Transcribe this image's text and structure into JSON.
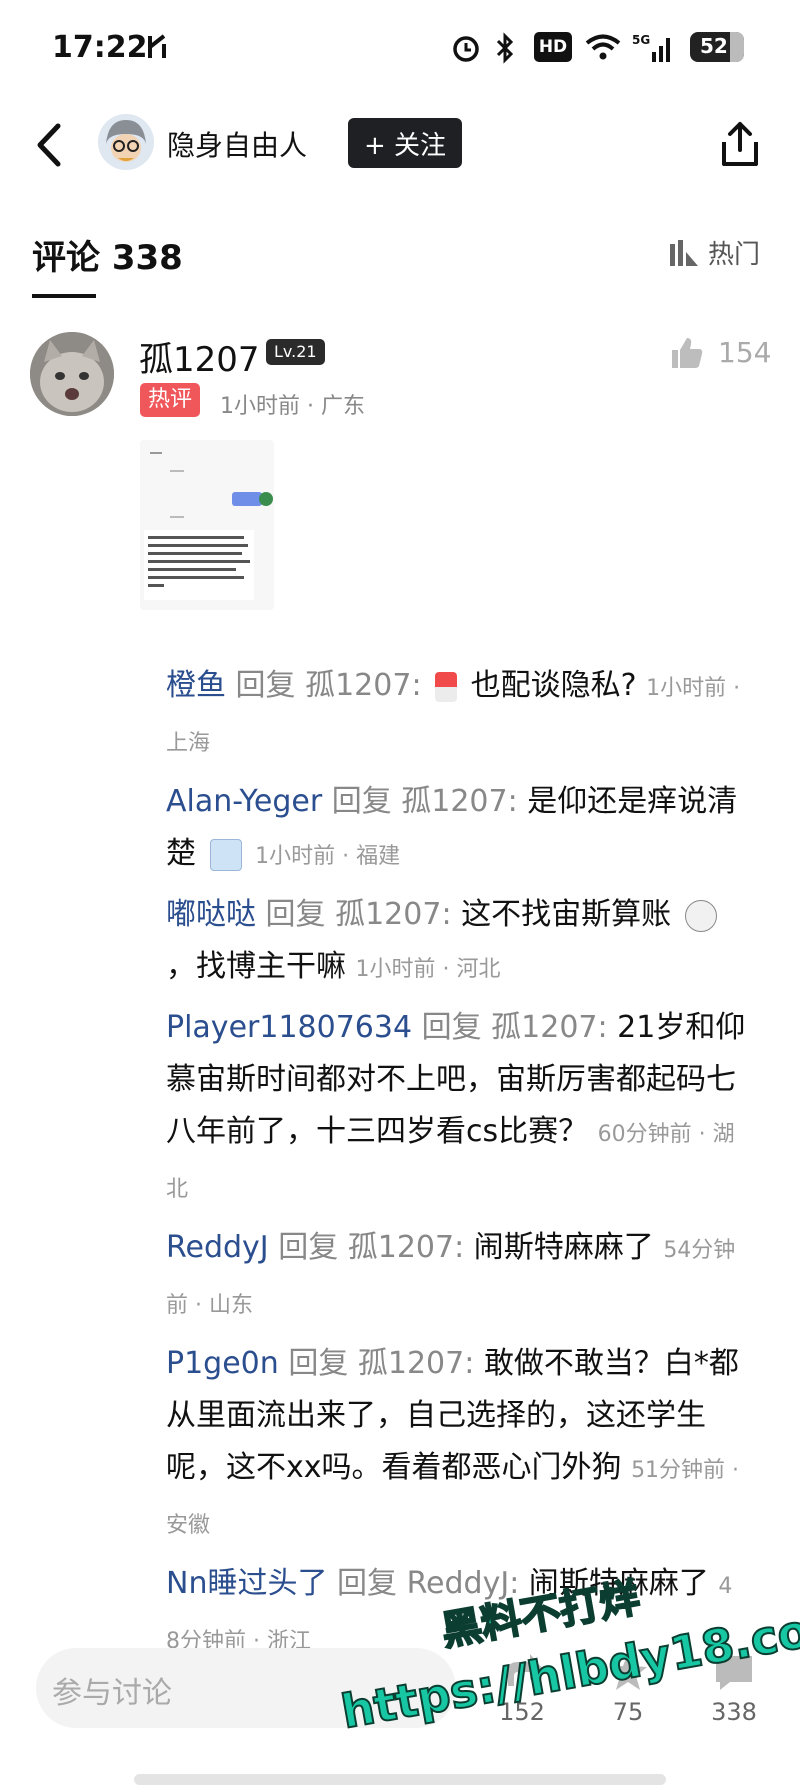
{
  "status": {
    "time": "17:22",
    "battery": "52"
  },
  "header": {
    "name": "隐身自由人",
    "follow_label": "+ 关注"
  },
  "comments_tab": {
    "title": "评论 338",
    "sort_label": "热门"
  },
  "comment": {
    "user": "孤1207",
    "level": "Lv.21",
    "likes": "154",
    "hot_tag": "热评",
    "meta": "1小时前 · 广东"
  },
  "replies": [
    {
      "user": "橙鱼",
      "reply_word": "回复",
      "target": "孤1207:",
      "text_before": "",
      "has_emoji_a": true,
      "text": "也配谈隐私?",
      "time": "1小时前 · 上海"
    },
    {
      "user": "Alan-Yeger",
      "reply_word": "回复",
      "target": "孤1207:",
      "text_before": "是仰还是痒说清楚",
      "has_emoji_b": true,
      "text": "",
      "time": "1小时前 · 福建"
    },
    {
      "user": "嘟哒哒",
      "reply_word": "回复",
      "target": "孤1207:",
      "text_before": "这不找宙斯算账",
      "has_emoji_c": true,
      "text": "，找博主干嘛",
      "time": "1小时前 · 河北"
    },
    {
      "user": "Player11807634",
      "reply_word": "回复",
      "target": "孤1207:",
      "text_before": "",
      "text": "21岁和仰慕宙斯时间都对不上吧，宙斯厉害都起码七八年前了，十三四岁看cs比赛？",
      "time": "60分钟前 · 湖北"
    },
    {
      "user": "ReddyJ",
      "reply_word": "回复",
      "target": "孤1207:",
      "text_before": "",
      "text": "闹斯特麻麻了",
      "time": "54分钟前 · 山东"
    },
    {
      "user": "P1ge0n",
      "reply_word": "回复",
      "target": "孤1207:",
      "text_before": "",
      "text": "敢做不敢当？白*都从里面流出来了，自己选择的，这还学生呢，这不xx吗。看着都恶心门外狗",
      "time": "51分钟前 · 安徽"
    },
    {
      "user": "Nn睡过头了",
      "reply_word": "回复",
      "target": "ReddyJ:",
      "text_before": "",
      "text": "闹斯特麻麻了",
      "time": "48分钟前 · 浙江"
    }
  ],
  "bottom": {
    "placeholder": "参与讨论",
    "stat1": "152",
    "stat2": "75",
    "stat3": "338"
  },
  "watermark": {
    "line1": "黑料不打烊",
    "line2": "https://hlbdy18.com"
  },
  "colors": {
    "reply_user": "#2b4e8f",
    "hot_tag": "#f0575a",
    "follow_bg": "#1f2023",
    "watermark": "#17c7a3"
  }
}
